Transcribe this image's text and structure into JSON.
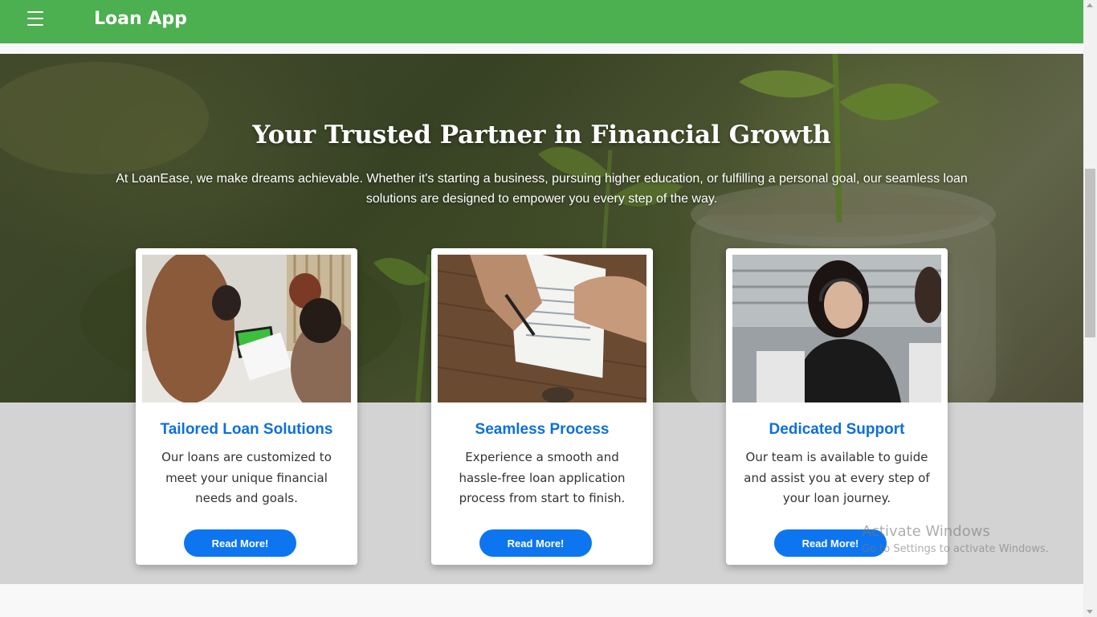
{
  "navbar": {
    "brand": "Loan App",
    "menu_icon": "hamburger-menu-icon",
    "color": "#4caf50"
  },
  "hero": {
    "title": "Your Trusted Partner in Financial Growth",
    "text": "At LoanEase, we make dreams achievable. Whether it's starting a business, pursuing higher education, or fulfilling a personal goal, our seamless loan solutions are designed to empower you every step of the way."
  },
  "cards": [
    {
      "title": "Tailored Loan Solutions",
      "description": "Our loans are customized to meet your unique financial needs and goals.",
      "button": "Read More!"
    },
    {
      "title": "Seamless Process",
      "description": "Experience a smooth and hassle-free loan application process from start to finish.",
      "button": "Read More!"
    },
    {
      "title": "Dedicated Support",
      "description": "Our team is available to guide and assist you at every step of your loan journey.",
      "button": "Read More!"
    }
  ],
  "watermark": {
    "title": "Activate Windows",
    "subtitle": "Go to Settings to activate Windows."
  },
  "colors": {
    "accent": "#0d75f0",
    "card_title": "#0d6fde",
    "band": "#d3d3d3"
  }
}
